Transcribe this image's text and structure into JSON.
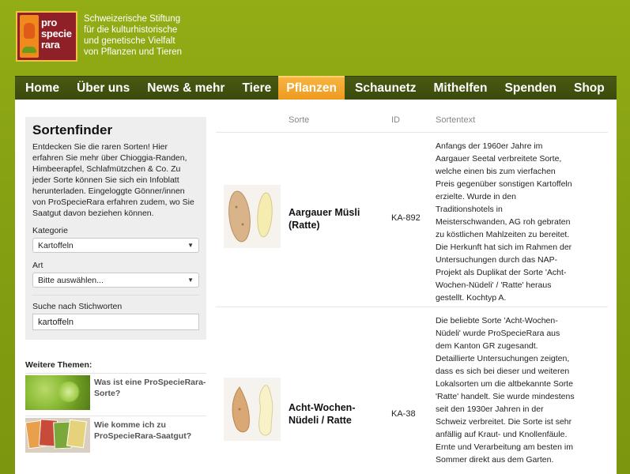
{
  "header": {
    "logo_lines": [
      "pro",
      "specie",
      "rara"
    ],
    "tagline_lines": [
      "Schweizerische Stiftung",
      "für die kulturhistorische",
      "und genetische Vielfalt",
      "von Pflanzen und Tieren"
    ]
  },
  "nav": {
    "items": [
      "Home",
      "Über uns",
      "News & mehr",
      "Tiere",
      "Pflanzen",
      "Schaunetz",
      "Mithelfen",
      "Spenden",
      "Shop"
    ],
    "active": "Pflanzen"
  },
  "sidebar": {
    "title": "Sortenfinder",
    "intro": "Entdecken Sie die raren Sorten! Hier erfahren Sie mehr über Chioggia-Randen, Himbeerapfel, Schlafmützchen & Co. Zu jeder Sorte können Sie sich ein Infoblatt herunterladen. Eingeloggte Gönner/innen von ProSpecieRara erfahren zudem, wo Sie Saatgut davon beziehen können.",
    "kategorie_label": "Kategorie",
    "kategorie_value": "Kartoffeln",
    "art_label": "Art",
    "art_value": "Bitte auswählen...",
    "search_label": "Suche nach Stichworten",
    "search_value": "kartoffeln"
  },
  "more_topics": {
    "title": "Weitere Themen:",
    "items": [
      {
        "text": "Was ist eine ProSpecieRara-Sorte?"
      },
      {
        "text": "Wie komme ich zu ProSpecieRara-Saatgut?"
      }
    ]
  },
  "table": {
    "headers": {
      "sorte": "Sorte",
      "id": "ID",
      "text": "Sortentext"
    },
    "rows": [
      {
        "name": "Aargauer Müsli (Ratte)",
        "id": "KA-892",
        "text": "Anfangs der 1960er Jahre im Aargauer Seetal verbreitete Sorte, welche einen bis zum vierfachen Preis gegenüber sonstigen Kartoffeln erzielte. Wurde in den Traditionshotels in Meisterschwanden, AG roh gebraten zu köstlichen Mahlzeiten zu bereitet. Die Herkunft hat sich im Rahmen der Untersuchungen durch das NAP-Projekt als Duplikat der Sorte 'Acht-Wochen-Nüdeli' / 'Ratte' heraus gestellt. Kochtyp A."
      },
      {
        "name": "Acht-Wochen-Nüdeli / Ratte",
        "id": "KA-38",
        "text": "Die beliebte Sorte 'Acht-Wochen-Nüdeli' wurde ProSpecieRara aus dem Kanton GR zugesandt. Detaillierte Untersuchungen zeigten, dass es sich bei dieser und weiteren Lokalsorten um die altbekannte Sorte 'Ratte' handelt. Sie wurde mindestens seit den 1930er Jahren in der Schweiz verbreitet. Die Sorte ist sehr anfällig auf Kraut- und Knollenfäule. Ernte und Verarbeitung am besten im Sommer direkt aus dem Garten."
      }
    ]
  },
  "colors": {
    "background": "#86a112",
    "nav": "#3f4f0e",
    "nav_active": "#f2a52a",
    "logo_red": "#8f2027",
    "logo_orange": "#f08a1c"
  }
}
